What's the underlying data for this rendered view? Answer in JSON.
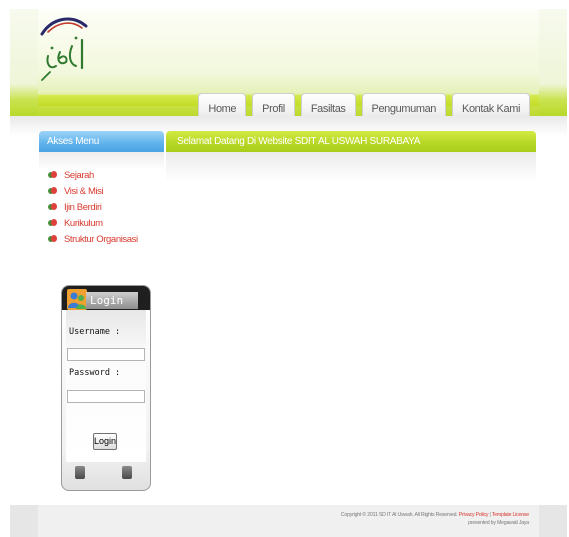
{
  "nav": {
    "tabs": [
      "Home",
      "Profil",
      "Fasiltas",
      "Pengumuman",
      "Kontak Kami"
    ]
  },
  "sidebar": {
    "title": "Akses Menu",
    "items": [
      "Sejarah",
      "Visi & Misi",
      "Ijin Berdiri",
      "Kurikulum",
      "Struktur Organisasi"
    ]
  },
  "main": {
    "title": "Selamat Datang Di Website SDIT AL USWAH SURABAYA"
  },
  "login": {
    "title": "Login",
    "username_label": "Username :",
    "password_label": "Password :",
    "button_label": "Login"
  },
  "footer": {
    "copyright": "Copyright © 2011 SD IT Al Uswah. All Rights Reserved.",
    "privacy_link": "Privacy Policy",
    "separator": "|",
    "license_link": "Template License",
    "credit": "presented by Megawati Jaya"
  },
  "colors": {
    "header_accent": "#bdd92c",
    "sidebar_header": "#5fb2ec",
    "main_header": "#b6d624",
    "menu_link": "#d83a2e"
  },
  "icons": {
    "logo": "calligraphy-logo",
    "menu_bullet": "flower-bullet-icon",
    "login": "users-icon"
  }
}
